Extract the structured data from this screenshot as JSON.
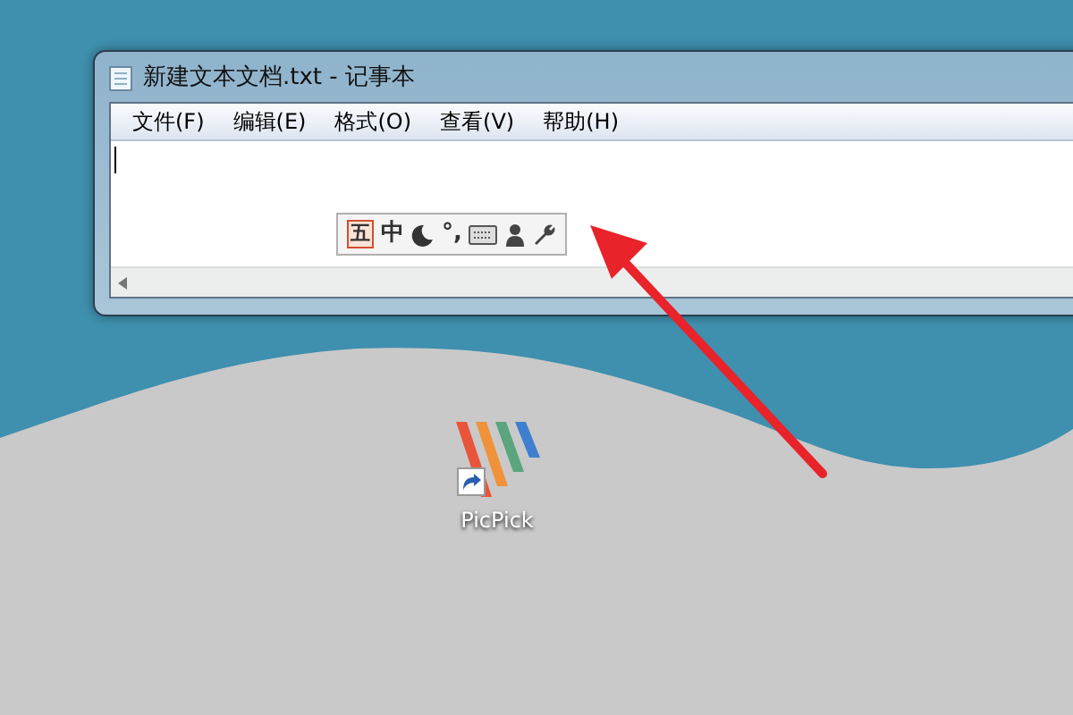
{
  "window": {
    "title": "新建文本文档.txt - 记事本",
    "menu": [
      "文件(F)",
      "编辑(E)",
      "格式(O)",
      "查看(V)",
      "帮助(H)"
    ]
  },
  "ime_toolbar": {
    "items": [
      {
        "kind": "text",
        "label": "五",
        "boxed": true
      },
      {
        "kind": "text",
        "label": "中",
        "boxed": false
      },
      {
        "kind": "moon"
      },
      {
        "kind": "text",
        "label": "°,",
        "boxed": false
      },
      {
        "kind": "keyboard"
      },
      {
        "kind": "person"
      },
      {
        "kind": "wrench"
      }
    ]
  },
  "desktop_icon": {
    "label": "PicPick",
    "shortcut": true
  }
}
